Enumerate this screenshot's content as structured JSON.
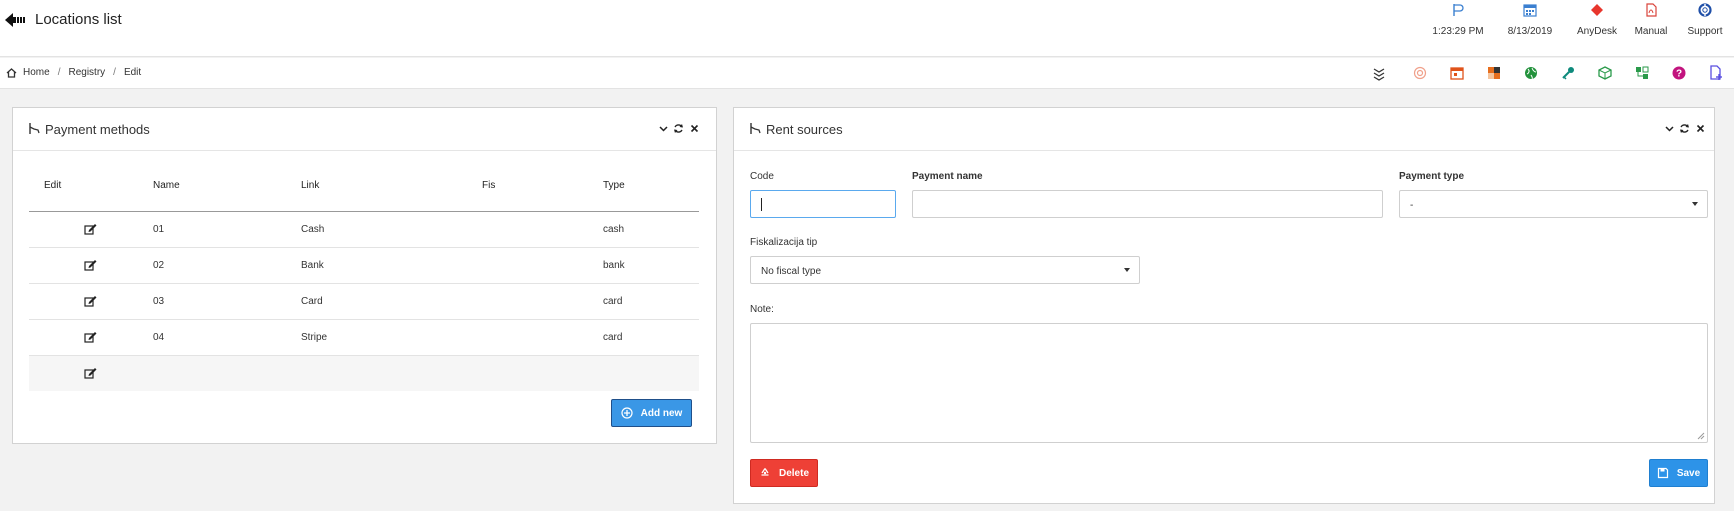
{
  "header": {
    "title": "Locations list",
    "tools": [
      {
        "label": "1:23:29 PM",
        "icon": "clock-flag-icon"
      },
      {
        "label": "8/13/2019",
        "icon": "calendar-icon"
      },
      {
        "label": "AnyDesk",
        "icon": "anydesk-icon"
      },
      {
        "label": "Manual",
        "icon": "pdf-icon"
      },
      {
        "label": "Support",
        "icon": "lifebuoy-icon"
      }
    ]
  },
  "breadcrumb": {
    "home": "Home",
    "registry": "Registry",
    "edit": "Edit",
    "sep": "/"
  },
  "quick_icons": [
    "layers-icon",
    "target-icon",
    "calendar-grid-icon",
    "checker-icon",
    "globe-icon",
    "key-icon",
    "cube-icon",
    "sitemap-icon",
    "help-icon",
    "new-document-icon"
  ],
  "payment_methods": {
    "title": "Payment methods",
    "columns": {
      "edit": "Edit",
      "name": "Name",
      "link": "Link",
      "fis": "Fis",
      "type": "Type"
    },
    "rows": [
      {
        "name": "01",
        "link": "Cash",
        "fis": "",
        "type": "cash"
      },
      {
        "name": "02",
        "link": "Bank",
        "fis": "",
        "type": "bank"
      },
      {
        "name": "03",
        "link": "Card",
        "fis": "",
        "type": "card"
      },
      {
        "name": "04",
        "link": "Stripe",
        "fis": "",
        "type": "card"
      }
    ],
    "add_label": "Add new"
  },
  "rent_sources": {
    "title": "Rent sources",
    "code_label": "Code",
    "code_value": "",
    "payment_name_label": "Payment name",
    "payment_name_value": "",
    "payment_type_label": "Payment type",
    "payment_type_value": "-",
    "fiscal_label": "Fiskalizacija tip",
    "fiscal_value": "No fiscal type",
    "note_label": "Note:",
    "note_value": "",
    "delete_label": "Delete",
    "save_label": "Save"
  },
  "colors": {
    "primary": "#2d93e8",
    "danger": "#ee4036"
  }
}
